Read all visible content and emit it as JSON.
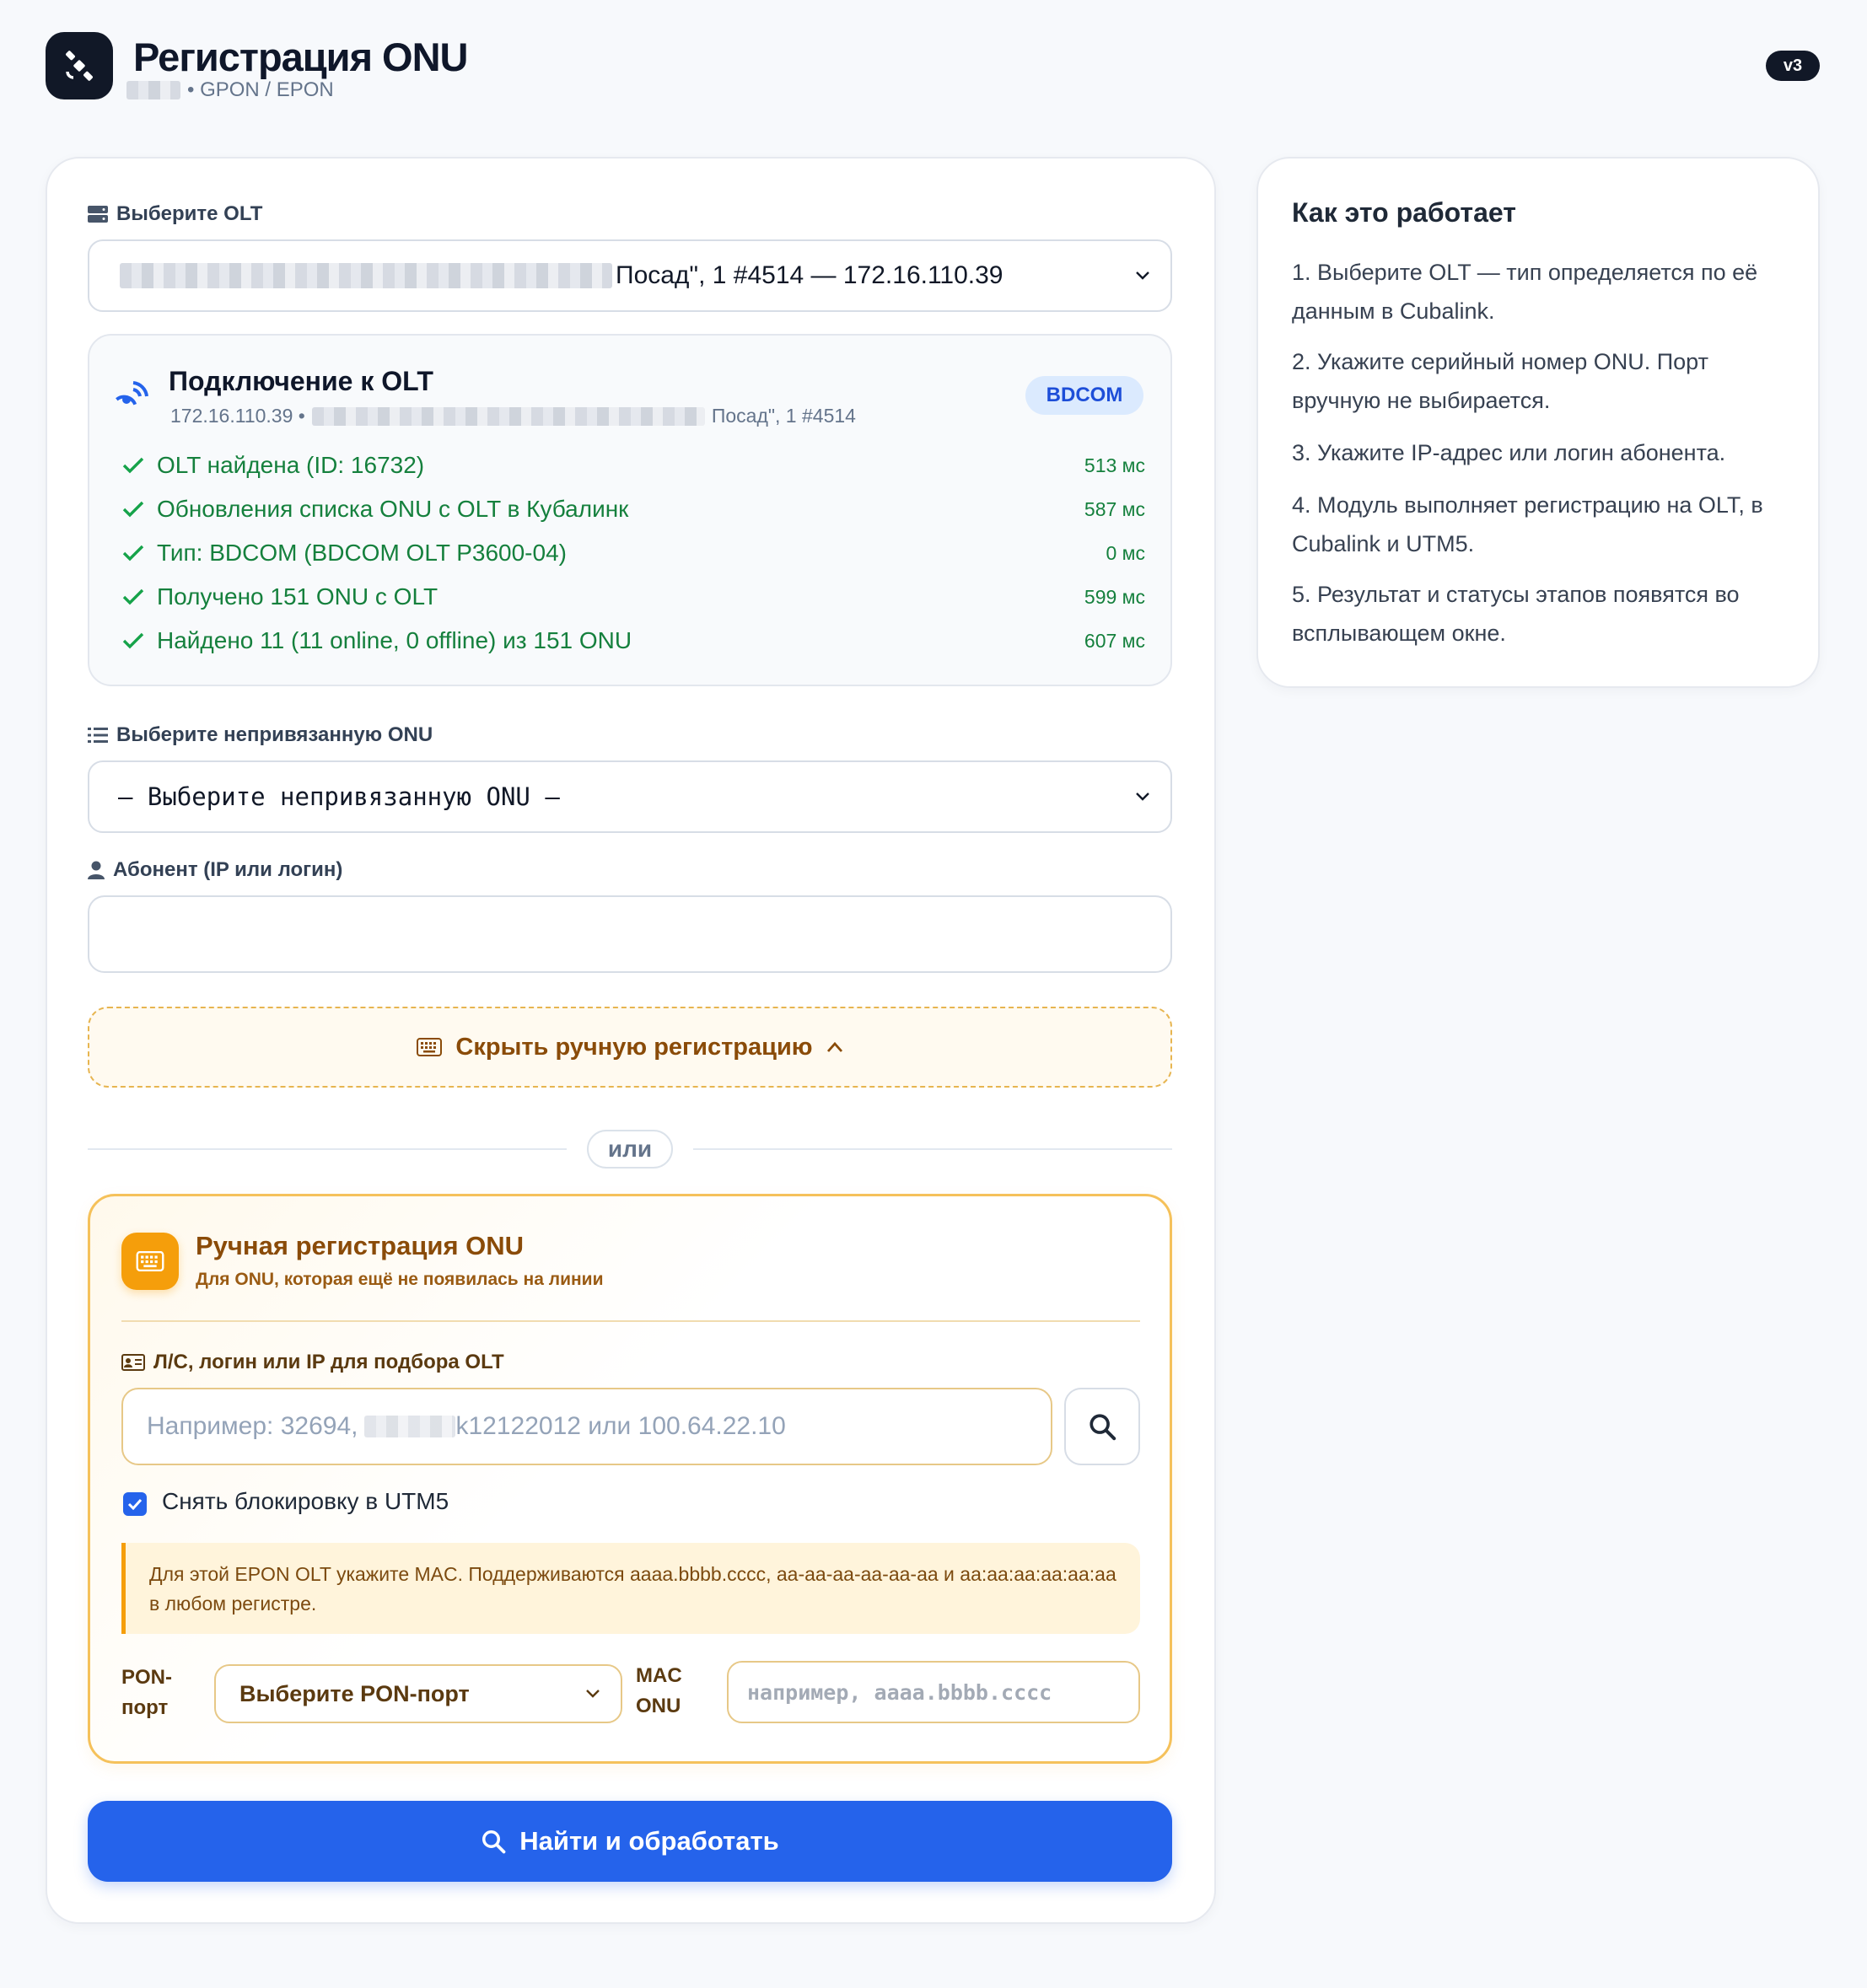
{
  "header": {
    "title": "Регистрация ONU",
    "subtitle": "• GPON / EPON",
    "version": "v3"
  },
  "olt": {
    "label": "Выберите OLT",
    "selected_visible": "Посад\", 1 #4514 — 172.16.110.39"
  },
  "connection": {
    "title": "Подключение к OLT",
    "ip": "172.16.110.39 •",
    "address_tail": "Посад\", 1 #4514",
    "badge": "BDCOM",
    "steps": [
      {
        "text": "OLT найдена (ID: 16732)",
        "time": "513 мс"
      },
      {
        "text": "Обновления списка ONU с OLT в Кубалинк",
        "time": "587 мс"
      },
      {
        "text": "Тип: BDCOM (BDCOM OLT P3600-04)",
        "time": "0 мс"
      },
      {
        "text": "Получено 151 ONU с OLT",
        "time": "599 мс"
      },
      {
        "text": "Найдено 11 (11 online, 0 offline) из 151 ONU",
        "time": "607 мс"
      }
    ]
  },
  "onu": {
    "label": "Выберите непривязанную ONU",
    "selected": "— Выберите непривязанную ONU —"
  },
  "subscriber": {
    "label": "Абонент (IP или логин)",
    "value": ""
  },
  "toggle": {
    "label": "Скрыть ручную регистрацию"
  },
  "or_label": "или",
  "manual": {
    "title": "Ручная регистрация ONU",
    "subtitle": "Для ONU, которая ещё не появилась на линии",
    "search_label": "Л/С, логин или IP для подбора OLT",
    "search_placeholder_a": "Например: 32694,",
    "search_placeholder_b": "k12122012 или 100.64.22.10",
    "unlock_label": "Снять блокировку в UTM5",
    "unlock_checked": true,
    "note": "Для этой EPON OLT укажите MAC. Поддерживаются aaaa.bbbb.cccc, aa-aa-aa-aa-aa-aa и aa:aa:aa:aa:aa:aa в любом регистре.",
    "pon_label_1": "PON-",
    "pon_label_2": "порт",
    "pon_select": "Выберите PON-порт",
    "mac_label_1": "MAC",
    "mac_label_2": "ONU",
    "mac_placeholder": "например, aaaa.bbbb.cccc"
  },
  "submit_label": "Найти и обработать",
  "howto": {
    "title": "Как это работает",
    "items": [
      "1. Выберите OLT — тип определяется по её данным в Cubalink.",
      "2. Укажите серийный номер ONU. Порт вручную не выбирается.",
      "3. Укажите IP-адрес или логин абонента.",
      "4. Модуль выполняет регистрацию на OLT, в Cubalink и UTM5.",
      "5. Результат и статусы этапов появятся во всплывающем окне."
    ]
  },
  "colors": {
    "accent": "#2563eb",
    "success": "#15803d",
    "warning": "#f59e0b",
    "dark": "#111827"
  },
  "icons": [
    "satellite-icon",
    "server-icon",
    "signal-icon",
    "check-icon",
    "list-icon",
    "user-icon",
    "keyboard-icon",
    "chevron-up-icon",
    "id-card-icon",
    "search-icon",
    "chevron-down-icon"
  ]
}
